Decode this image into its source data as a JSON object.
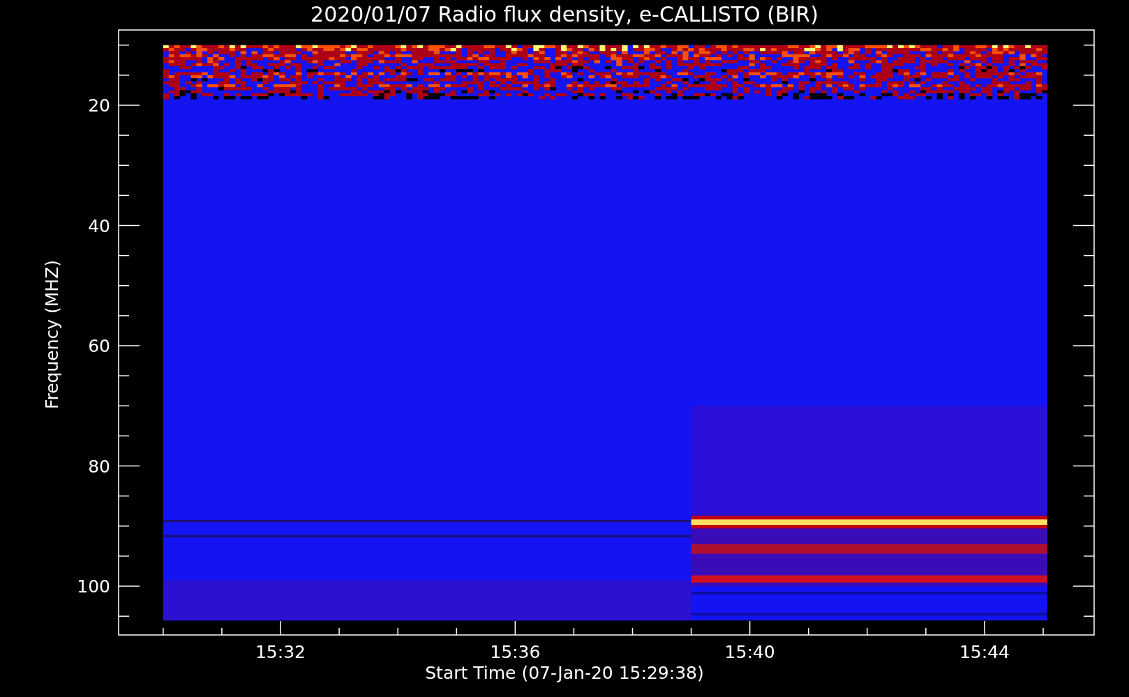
{
  "title": "2020/01/07  Radio flux density, e-CALLISTO (BIR)",
  "y_axis": {
    "label": "Frequency (MHZ)",
    "ticks": [
      "20",
      "40",
      "60",
      "80",
      "100"
    ]
  },
  "x_axis": {
    "label": "Start Time (07-Jan-20 15:29:38)",
    "ticks": [
      "15:32",
      "15:36",
      "15:40",
      "15:44"
    ]
  }
}
